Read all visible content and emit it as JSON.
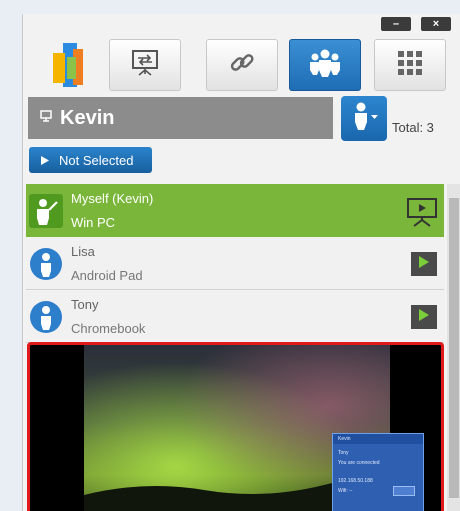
{
  "window": {
    "minimize_label": "–",
    "close_label": "×"
  },
  "toolbar": {
    "items": [
      {
        "name": "logo",
        "icon": "app-logo-icon"
      },
      {
        "name": "screen-share",
        "icon": "screen-share-icon"
      },
      {
        "name": "link",
        "icon": "link-icon"
      },
      {
        "name": "users",
        "icon": "users-group-icon",
        "active": true
      },
      {
        "name": "apps",
        "icon": "grid-icon"
      }
    ]
  },
  "header": {
    "name": "Kevin",
    "total_label": "Total: 3"
  },
  "not_selected_button": {
    "label": "Not Selected"
  },
  "participants": [
    {
      "name": "Myself (Kevin)",
      "device": "Win PC",
      "self": true
    },
    {
      "name": "Lisa",
      "device": "Android Pad",
      "self": false
    },
    {
      "name": "Tony",
      "device": "Chromebook",
      "self": false
    }
  ],
  "preview_mini": {
    "title": "Kevin",
    "line1": "Tony",
    "line2": "You are connected",
    "line3": "192.168.50.188",
    "line4": "Wifi: --",
    "button": "OK Exit"
  },
  "colors": {
    "accent_blue": "#1e6db5",
    "self_green": "#7ab63a",
    "highlight_red": "#e01a1a"
  }
}
